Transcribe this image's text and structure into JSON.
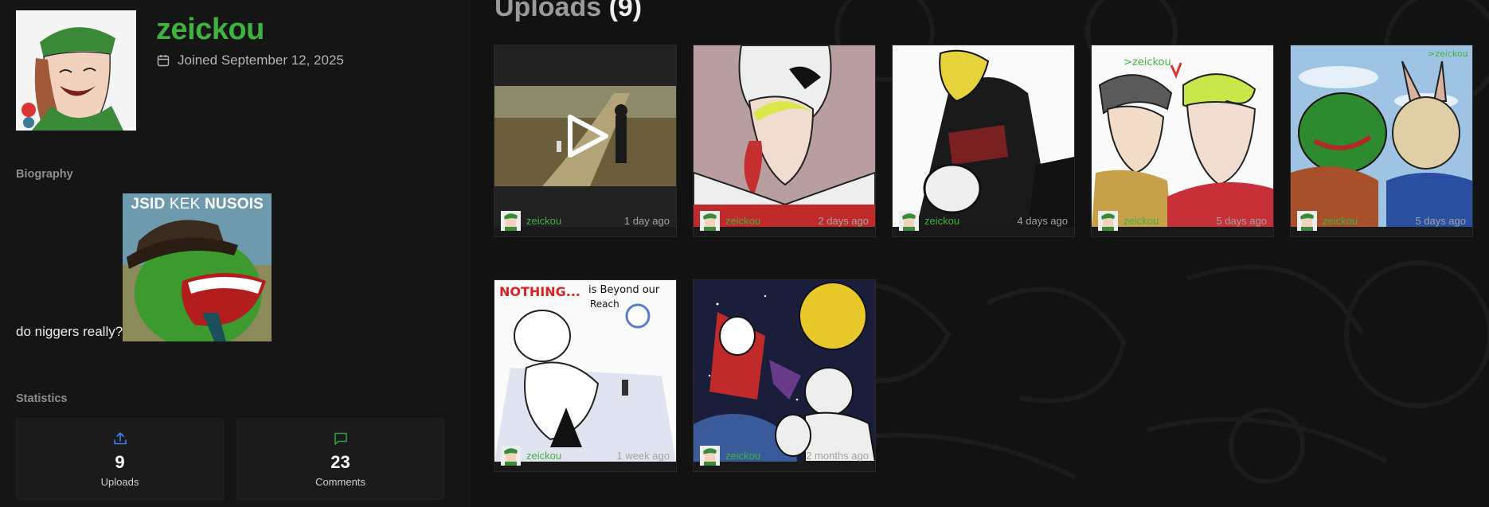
{
  "profile": {
    "username": "zeickou",
    "joined": "Joined September 12, 2025",
    "avatar_icon": "avatar-image"
  },
  "biography": {
    "label": "Biography",
    "text": "do niggers really?",
    "image_caption_parts": [
      "JSID",
      "KEK",
      "NUSOIS"
    ]
  },
  "statistics": {
    "label": "Statistics",
    "uploads": {
      "value": "9",
      "label": "Uploads",
      "icon": "upload-icon"
    },
    "comments": {
      "value": "23",
      "label": "Comments",
      "icon": "comment-icon"
    }
  },
  "uploads": {
    "title": "Uploads",
    "count": "(9)",
    "items": [
      {
        "user": "zeickou",
        "time": "1 day ago",
        "type": "video"
      },
      {
        "user": "zeickou",
        "time": "2 days ago",
        "type": "image"
      },
      {
        "user": "zeickou",
        "time": "4 days ago",
        "type": "image"
      },
      {
        "user": "zeickou",
        "time": "5 days ago",
        "type": "image"
      },
      {
        "user": "zeickou",
        "time": "5 days ago",
        "type": "image"
      },
      {
        "user": "zeickou",
        "time": "1 week ago",
        "type": "image"
      },
      {
        "user": "zeickou",
        "time": "2 months ago",
        "type": "image"
      }
    ]
  },
  "colors": {
    "accent": "#3fb23f",
    "background": "#121212",
    "upload_icon": "#3b82f6",
    "comment_icon": "#2ea043"
  }
}
